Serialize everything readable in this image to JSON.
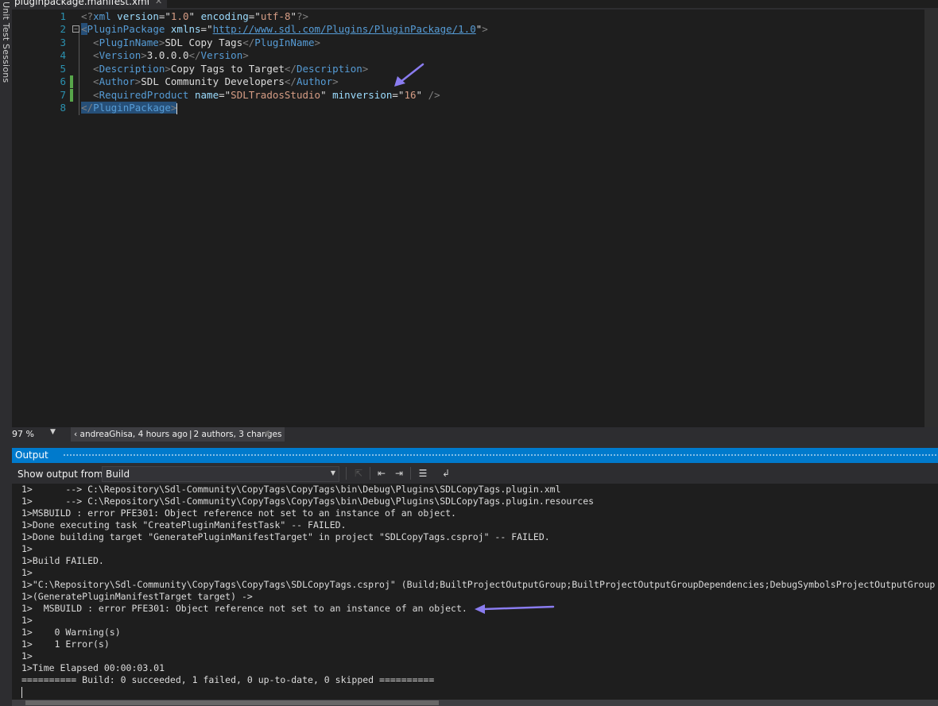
{
  "side_panel": {
    "label": "Unit Test Sessions"
  },
  "document_tab": {
    "title": "pluginpackage.manifest.xml",
    "pin_glyph": "⊣",
    "close_glyph": "✕"
  },
  "editor": {
    "line_numbers": [
      "1",
      "2",
      "3",
      "4",
      "5",
      "6",
      "7",
      "8"
    ],
    "fold_glyph": "−",
    "lines": [
      [
        {
          "t": "<?",
          "c": "bracket"
        },
        {
          "t": "xml",
          "c": "tag"
        },
        {
          "t": " ",
          "c": "text"
        },
        {
          "t": "version",
          "c": "attr"
        },
        {
          "t": "=\"",
          "c": "text"
        },
        {
          "t": "1.0",
          "c": "val"
        },
        {
          "t": "\"",
          "c": "text"
        },
        {
          "t": " ",
          "c": "text"
        },
        {
          "t": "encoding",
          "c": "attr"
        },
        {
          "t": "=\"",
          "c": "text"
        },
        {
          "t": "utf-8",
          "c": "val"
        },
        {
          "t": "\"",
          "c": "text"
        },
        {
          "t": "?>",
          "c": "bracket"
        }
      ],
      [
        {
          "t": "<",
          "c": "bracket hl"
        },
        {
          "t": "PluginPackage",
          "c": "tag"
        },
        {
          "t": " ",
          "c": "text"
        },
        {
          "t": "xmlns",
          "c": "attr"
        },
        {
          "t": "=\"",
          "c": "text"
        },
        {
          "t": "http://www.sdl.com/Plugins/PluginPackage/1.0",
          "c": "link"
        },
        {
          "t": "\"",
          "c": "text"
        },
        {
          "t": ">",
          "c": "bracket"
        }
      ],
      [
        {
          "t": "  <",
          "c": "bracket"
        },
        {
          "t": "PlugInName",
          "c": "tag"
        },
        {
          "t": ">",
          "c": "bracket"
        },
        {
          "t": "SDL Copy Tags",
          "c": "text"
        },
        {
          "t": "</",
          "c": "bracket"
        },
        {
          "t": "PlugInName",
          "c": "tag"
        },
        {
          "t": ">",
          "c": "bracket"
        }
      ],
      [
        {
          "t": "  <",
          "c": "bracket"
        },
        {
          "t": "Version",
          "c": "tag"
        },
        {
          "t": ">",
          "c": "bracket"
        },
        {
          "t": "3.0.0.0",
          "c": "text"
        },
        {
          "t": "</",
          "c": "bracket"
        },
        {
          "t": "Version",
          "c": "tag"
        },
        {
          "t": ">",
          "c": "bracket"
        }
      ],
      [
        {
          "t": "  <",
          "c": "bracket"
        },
        {
          "t": "Description",
          "c": "tag"
        },
        {
          "t": ">",
          "c": "bracket"
        },
        {
          "t": "Copy Tags to Target",
          "c": "text"
        },
        {
          "t": "</",
          "c": "bracket"
        },
        {
          "t": "Description",
          "c": "tag"
        },
        {
          "t": ">",
          "c": "bracket"
        }
      ],
      [
        {
          "t": "  <",
          "c": "bracket"
        },
        {
          "t": "Author",
          "c": "tag"
        },
        {
          "t": ">",
          "c": "bracket"
        },
        {
          "t": "SDL Community Developers",
          "c": "text"
        },
        {
          "t": "</",
          "c": "bracket"
        },
        {
          "t": "Author",
          "c": "tag"
        },
        {
          "t": ">",
          "c": "bracket"
        }
      ],
      [
        {
          "t": "  <",
          "c": "bracket"
        },
        {
          "t": "RequiredProduct",
          "c": "tag"
        },
        {
          "t": " ",
          "c": "text"
        },
        {
          "t": "name",
          "c": "attr"
        },
        {
          "t": "=\"",
          "c": "text"
        },
        {
          "t": "SDLTradosStudio",
          "c": "val"
        },
        {
          "t": "\"",
          "c": "text"
        },
        {
          "t": " ",
          "c": "text"
        },
        {
          "t": "minversion",
          "c": "attr"
        },
        {
          "t": "=\"",
          "c": "text"
        },
        {
          "t": "16",
          "c": "val"
        },
        {
          "t": "\"",
          "c": "text"
        },
        {
          "t": " />",
          "c": "bracket"
        }
      ],
      [
        {
          "t": "</",
          "c": "bracket hl"
        },
        {
          "t": "PluginPackage",
          "c": "tag hl"
        },
        {
          "t": ">",
          "c": "bracket hl"
        }
      ]
    ]
  },
  "status_bar": {
    "zoom": "97 %",
    "blame_author": "andreaGhisa, 4 hours ago",
    "blame_summary": "2 authors, 3 changes",
    "separator": "|"
  },
  "output": {
    "title": "Output",
    "show_from_label": "Show output from:",
    "source": "Build",
    "lines": [
      "1>      --> C:\\Repository\\Sdl-Community\\CopyTags\\CopyTags\\bin\\Debug\\Plugins\\SDLCopyTags.plugin.xml",
      "1>      --> C:\\Repository\\Sdl-Community\\CopyTags\\CopyTags\\bin\\Debug\\Plugins\\SDLCopyTags.plugin.resources",
      "1>MSBUILD : error PFE301: Object reference not set to an instance of an object.",
      "1>Done executing task \"CreatePluginManifestTask\" -- FAILED.",
      "1>Done building target \"GeneratePluginManifestTarget\" in project \"SDLCopyTags.csproj\" -- FAILED.",
      "1>",
      "1>Build FAILED.",
      "1>",
      "1>\"C:\\Repository\\Sdl-Community\\CopyTags\\CopyTags\\SDLCopyTags.csproj\" (Build;BuiltProjectOutputGroup;BuiltProjectOutputGroupDependencies;DebugSymbolsProjectOutputGroup",
      "1>(GeneratePluginManifestTarget target) ->",
      "1>  MSBUILD : error PFE301: Object reference not set to an instance of an object.",
      "1>",
      "1>    0 Warning(s)",
      "1>    1 Error(s)",
      "1>",
      "1>Time Elapsed 00:00:03.01",
      "========== Build: 0 succeeded, 1 failed, 0 up-to-date, 0 skipped =========="
    ]
  },
  "colors": {
    "accent": "#007acc",
    "annotation": "#8a7cf0",
    "change_bar": "#57a64a"
  }
}
